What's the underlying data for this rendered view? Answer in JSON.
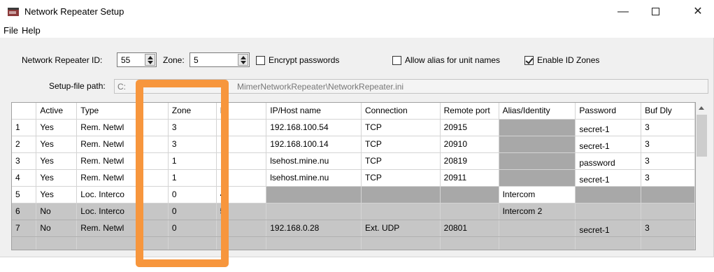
{
  "window": {
    "title": "Network Repeater Setup",
    "controls": {
      "minimize": "—",
      "close": "✕"
    }
  },
  "menu": [
    "File",
    "Help"
  ],
  "settings": {
    "repeater_id_label": "Network Repeater ID:",
    "repeater_id_value": "55",
    "zone_label": "Zone:",
    "zone_value": "5",
    "encrypt_label": "Encrypt passwords",
    "encrypt_checked": false,
    "alias_label": "Allow alias for unit names",
    "alias_checked": false,
    "id_zones_label": "Enable ID Zones",
    "id_zones_checked": true,
    "path_label": "Setup-file path:",
    "path_value_start": "C:",
    "path_value_end": "MimerNetworkRepeater\\NetworkRepeater.ini"
  },
  "table": {
    "headers": [
      "",
      "Active",
      "Type",
      "",
      "Zone",
      "I",
      "IP/Host name",
      "Connection",
      "Remote port",
      "Alias/Identity",
      "Password",
      "Buf Dly"
    ],
    "rows": [
      {
        "n": "1",
        "active": "Yes",
        "type": "Rem. Netwl",
        "zone": "3",
        "id": "",
        "host": "192.168.100.54",
        "conn": "TCP",
        "port": "20915",
        "alias": "",
        "pw": "secret-1",
        "buf": "3"
      },
      {
        "n": "2",
        "active": "Yes",
        "type": "Rem. Netwl",
        "zone": "3",
        "id": "",
        "host": "192.168.100.14",
        "conn": "TCP",
        "port": "20910",
        "alias": "",
        "pw": "secret-1",
        "buf": "3"
      },
      {
        "n": "3",
        "active": "Yes",
        "type": "Rem. Netwl",
        "zone": "1",
        "id": "",
        "host": "lsehost.mine.nu",
        "conn": "TCP",
        "port": "20819",
        "alias": "",
        "pw": "password",
        "buf": "3"
      },
      {
        "n": "4",
        "active": "Yes",
        "type": "Rem. Netwl",
        "zone": "1",
        "id": "",
        "host": "lsehost.mine.nu",
        "conn": "TCP",
        "port": "20911",
        "alias": "",
        "pw": "secret-1",
        "buf": "3"
      },
      {
        "n": "5",
        "active": "Yes",
        "type": "Loc. Interco",
        "zone": "0",
        "id": "4",
        "host": "",
        "conn": "",
        "port": "",
        "alias": "Intercom",
        "pw": "",
        "buf": ""
      },
      {
        "n": "6",
        "active": "No",
        "type": "Loc. Interco",
        "zone": "0",
        "id": "5",
        "host": "",
        "conn": "",
        "port": "",
        "alias": "Intercom 2",
        "pw": "",
        "buf": ""
      },
      {
        "n": "7",
        "active": "No",
        "type": "Rem. Netwl",
        "zone": "0",
        "id": "",
        "host": "192.168.0.28",
        "conn": "Ext. UDP",
        "port": "20801",
        "alias": "",
        "pw": "secret-1",
        "buf": "3"
      }
    ]
  }
}
